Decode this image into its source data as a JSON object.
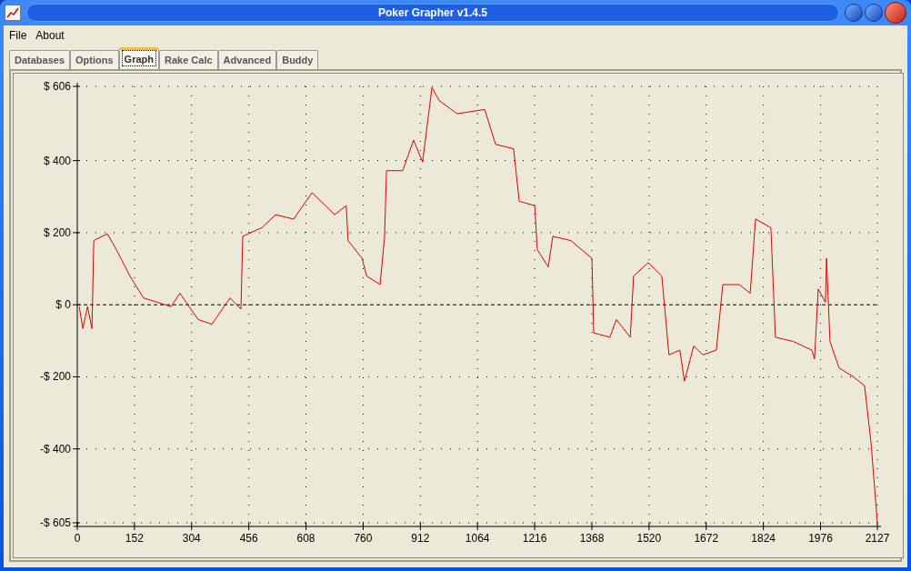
{
  "window": {
    "title": "Poker Grapher v1.4.5"
  },
  "menu": [
    "File",
    "About"
  ],
  "tabs": [
    {
      "label": "Databases",
      "selected": false
    },
    {
      "label": "Options",
      "selected": false
    },
    {
      "label": "Graph",
      "selected": true
    },
    {
      "label": "Rake Calc",
      "selected": false
    },
    {
      "label": "Advanced",
      "selected": false
    },
    {
      "label": "Buddy",
      "selected": false
    }
  ],
  "graph": {
    "chart_data": {
      "type": "line",
      "ylim": [
        -605,
        606
      ],
      "xlim": [
        0,
        2127
      ],
      "yticks": [
        {
          "value": 606,
          "label": "$ 606"
        },
        {
          "value": 400,
          "label": "$ 400"
        },
        {
          "value": 200,
          "label": "$ 200"
        },
        {
          "value": 0,
          "label": "$ 0"
        },
        {
          "value": -200,
          "label": "-$ 200"
        },
        {
          "value": -400,
          "label": "-$ 400"
        },
        {
          "value": -605,
          "label": "-$ 605"
        }
      ],
      "xticks": [
        0,
        152,
        304,
        456,
        608,
        760,
        912,
        1064,
        1216,
        1368,
        1520,
        1672,
        1824,
        1976,
        2127
      ],
      "grid": true,
      "x": [
        5,
        15,
        27,
        39,
        44,
        80,
        104,
        140,
        176,
        249,
        273,
        321,
        358,
        406,
        435,
        440,
        491,
        527,
        575,
        624,
        684,
        715,
        720,
        757,
        769,
        805,
        817,
        822,
        865,
        894,
        918,
        943,
        962,
        1010,
        1083,
        1112,
        1160,
        1175,
        1216,
        1223,
        1252,
        1264,
        1312,
        1368,
        1373,
        1416,
        1433,
        1470,
        1479,
        1518,
        1554,
        1573,
        1602,
        1614,
        1639,
        1663,
        1699,
        1716,
        1760,
        1789,
        1803,
        1844,
        1856,
        1904,
        1953,
        1960,
        1970,
        1989,
        1992,
        2001,
        2025,
        2062,
        2093,
        2110,
        2127
      ],
      "series": [
        {
          "color": "#e00000",
          "values": [
            -5,
            -66,
            -5,
            -66,
            178,
            197,
            153,
            80,
            19,
            -5,
            32,
            -41,
            -54,
            19,
            -12,
            190,
            214,
            250,
            238,
            311,
            250,
            275,
            178,
            129,
            80,
            56,
            190,
            372,
            372,
            457,
            396,
            603,
            567,
            530,
            542,
            445,
            433,
            287,
            275,
            153,
            105,
            190,
            178,
            129,
            -78,
            -90,
            -41,
            -90,
            80,
            117,
            80,
            -139,
            -126,
            -212,
            -114,
            -139,
            -126,
            56,
            56,
            32,
            238,
            214,
            -90,
            -102,
            -126,
            -151,
            44,
            7,
            129,
            -102,
            -175,
            -199,
            -224,
            -382,
            -605
          ]
        }
      ]
    }
  }
}
